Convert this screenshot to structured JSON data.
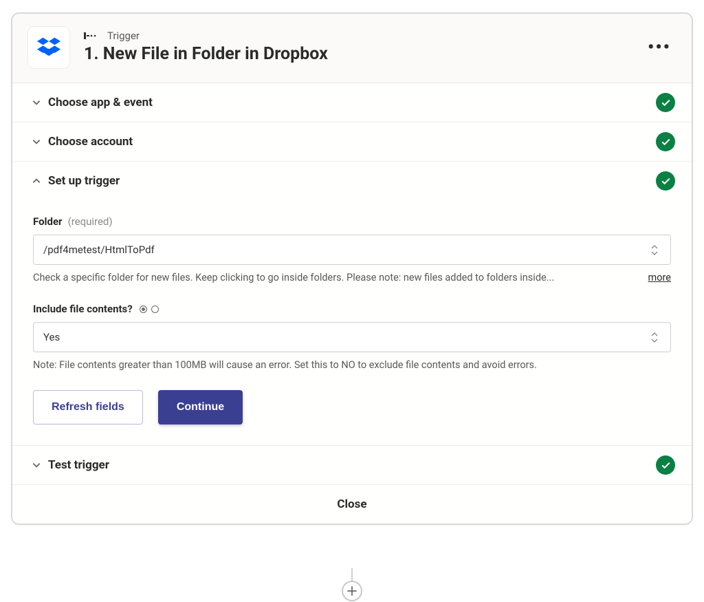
{
  "header": {
    "trigger_badge": "Trigger",
    "title": "1. New File in Folder in Dropbox",
    "app_icon": "dropbox-icon"
  },
  "sections": {
    "choose_app_event": {
      "label": "Choose app & event",
      "complete": true
    },
    "choose_account": {
      "label": "Choose account",
      "complete": true
    },
    "setup_trigger": {
      "label": "Set up trigger",
      "complete": true
    },
    "test_trigger": {
      "label": "Test trigger",
      "complete": true
    }
  },
  "fields": {
    "folder": {
      "label": "Folder",
      "required_label": "(required)",
      "value": "/pdf4metest/HtmlToPdf",
      "help": "Check a specific folder for new files. Keep clicking to go inside folders. Please note: new files added to folders inside...",
      "more": "more"
    },
    "include": {
      "label": "Include file contents?",
      "value": "Yes",
      "note": "Note: File contents greater than 100MB will cause an error. Set this to NO to exclude file contents and avoid errors."
    }
  },
  "buttons": {
    "refresh": "Refresh fields",
    "continue": "Continue",
    "close": "Close"
  }
}
